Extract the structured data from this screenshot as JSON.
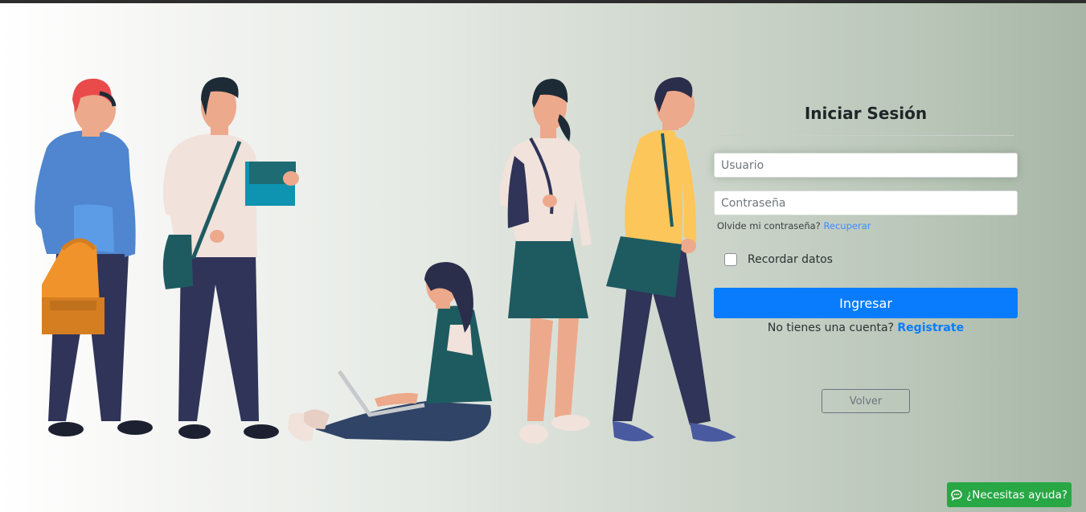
{
  "login": {
    "title": "Iniciar Sesión",
    "username_placeholder": "Usuario",
    "password_placeholder": "Contraseña",
    "forgot_text": "Olvide mi contraseña?",
    "forgot_link": "Recuperar",
    "remember_label": "Recordar datos",
    "remember_checked": false,
    "submit_label": "Ingresar",
    "signup_text": "No tienes una cuenta?",
    "signup_link": "Registrate",
    "back_label": "Volver"
  },
  "help": {
    "label": "¿Necesitas ayuda?",
    "icon": "chat-icon"
  },
  "colors": {
    "primary": "#087cfc",
    "success": "#28a745",
    "secondary": "#6c757d"
  }
}
